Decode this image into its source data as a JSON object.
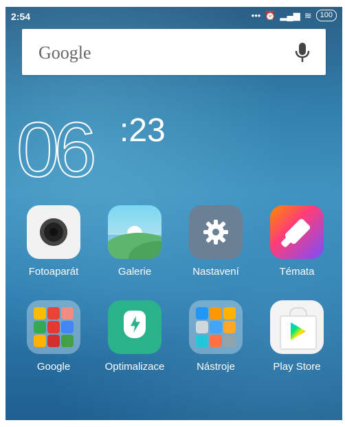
{
  "status_bar": {
    "time": "2:54",
    "icons": [
      "more-dots-icon",
      "alarm-icon",
      "signal-icon",
      "wifi-icon"
    ],
    "battery": "100"
  },
  "search": {
    "brand_text": "Google",
    "mic_icon": "mic-icon"
  },
  "clock": {
    "hour": "06",
    "minute": ":23"
  },
  "apps": [
    {
      "label": "Fotoaparát",
      "icon": "camera-icon"
    },
    {
      "label": "Galerie",
      "icon": "gallery-icon"
    },
    {
      "label": "Nastavení",
      "icon": "settings-icon"
    },
    {
      "label": "Témata",
      "icon": "themes-icon"
    },
    {
      "label": "Google",
      "icon": "google-folder-icon"
    },
    {
      "label": "Optimalizace",
      "icon": "optimize-icon"
    },
    {
      "label": "Nástroje",
      "icon": "tools-folder-icon"
    },
    {
      "label": "Play Store",
      "icon": "play-store-icon"
    }
  ],
  "colors": {
    "accent": "#2f7aa8",
    "white": "#ffffff"
  }
}
